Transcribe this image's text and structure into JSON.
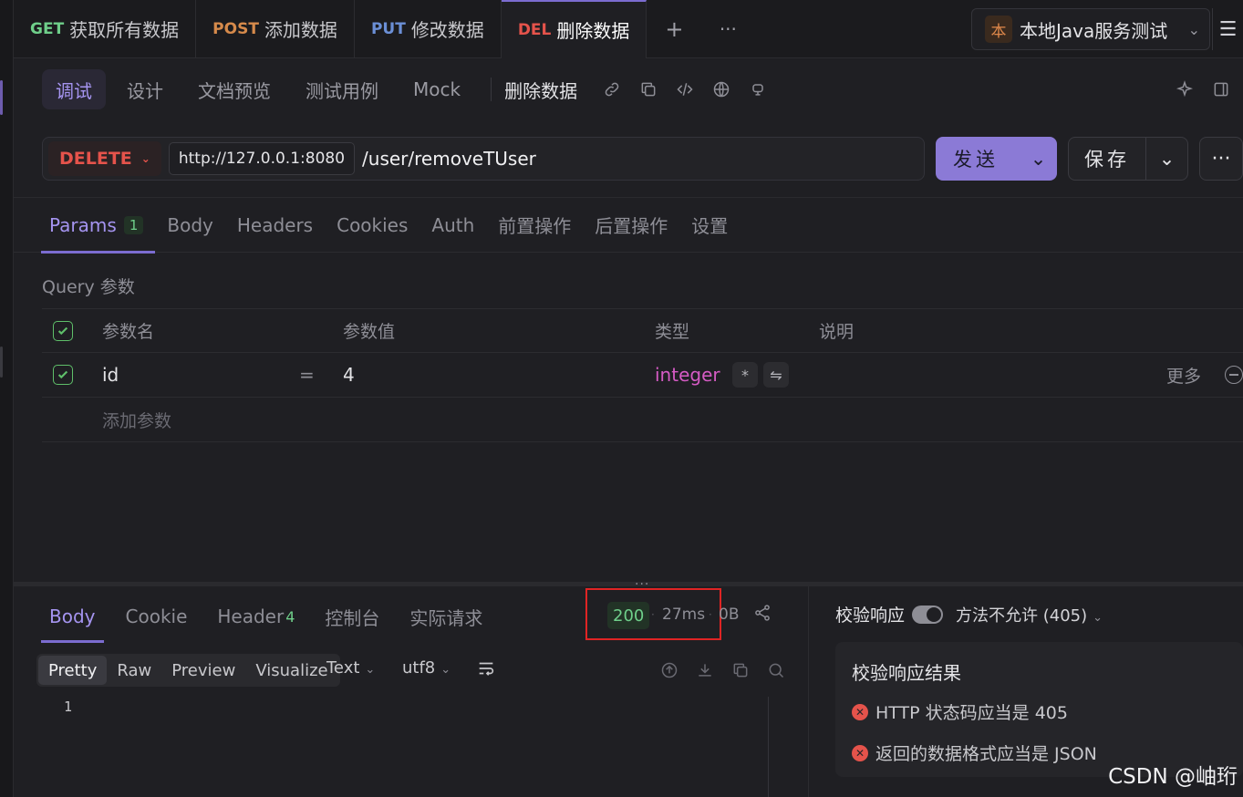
{
  "tabs": [
    {
      "method": "GET",
      "method_color": "#6fcf8a",
      "label": "获取所有数据"
    },
    {
      "method": "POST",
      "method_color": "#d68a4b",
      "label": "添加数据"
    },
    {
      "method": "PUT",
      "method_color": "#6b8fd6",
      "label": "修改数据"
    },
    {
      "method": "DEL",
      "method_color": "#e5534b",
      "label": "删除数据"
    }
  ],
  "tab_actions": {
    "add": "+",
    "more": "···"
  },
  "env": {
    "badge": "本",
    "name": "本地Java服务测试"
  },
  "subtabs": [
    "调试",
    "设计",
    "文档预览",
    "测试用例",
    "Mock"
  ],
  "api_name": "删除数据",
  "request": {
    "method": "DELETE",
    "base_url": "http://127.0.0.1:8080",
    "path": "/user/removeTUser",
    "send_label": "发送",
    "save_label": "保存"
  },
  "req_tabs": [
    {
      "label": "Params",
      "count": "1"
    },
    {
      "label": "Body"
    },
    {
      "label": "Headers"
    },
    {
      "label": "Cookies"
    },
    {
      "label": "Auth"
    },
    {
      "label": "前置操作"
    },
    {
      "label": "后置操作"
    },
    {
      "label": "设置"
    }
  ],
  "query_label": "Query 参数",
  "params": {
    "headers": {
      "name": "参数名",
      "value": "参数值",
      "type": "类型",
      "desc": "说明"
    },
    "rows": [
      {
        "name": "id",
        "eq": "=",
        "value": "4",
        "type": "integer",
        "required": "*"
      }
    ],
    "more": "更多",
    "add": "添加参数"
  },
  "response": {
    "tabs": [
      {
        "label": "Body"
      },
      {
        "label": "Cookie"
      },
      {
        "label": "Header",
        "count": "4"
      },
      {
        "label": "控制台"
      },
      {
        "label": "实际请求"
      }
    ],
    "status_code": "200",
    "time": "27ms",
    "size": "0B",
    "formats": [
      "Pretty",
      "Raw",
      "Preview",
      "Visualize"
    ],
    "text_type": "Text",
    "encoding": "utf8",
    "line_number": "1"
  },
  "validation": {
    "label": "校验响应",
    "select": "方法不允许 (405)",
    "result_title": "校验响应结果",
    "items": [
      "HTTP 状态码应当是 405",
      "返回的数据格式应当是 JSON"
    ]
  },
  "watermark": "CSDN @岫珩"
}
